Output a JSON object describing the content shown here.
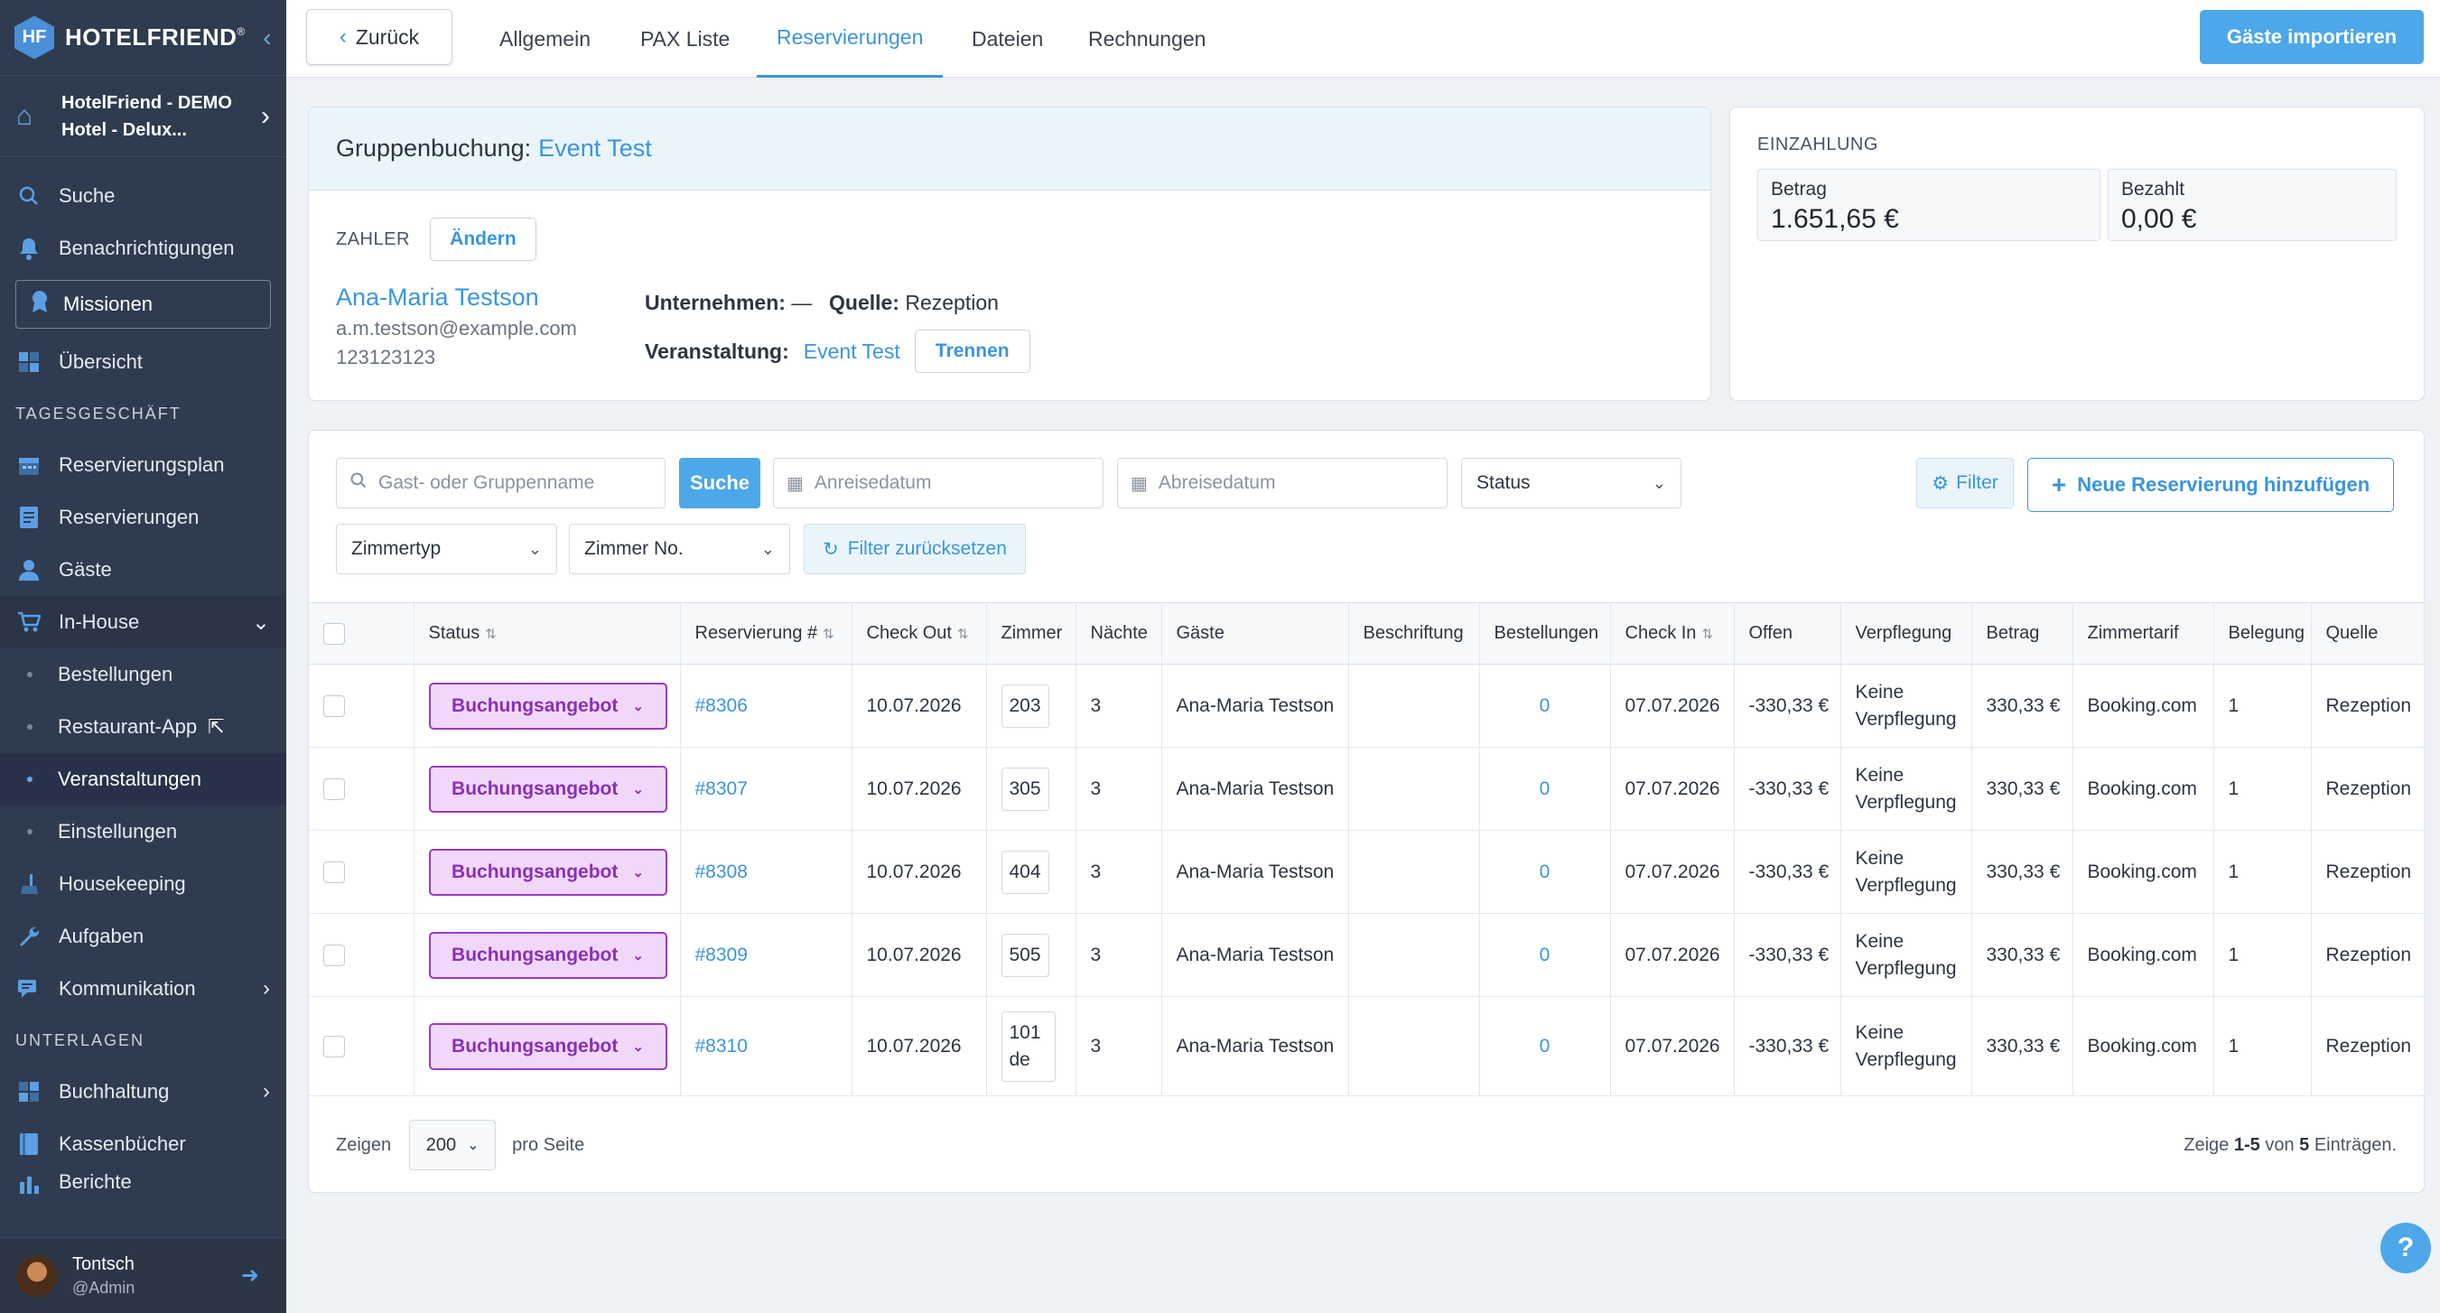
{
  "brand": {
    "name": "HOTELFRIEND",
    "logo_letters": "HF",
    "accent": "#3a95dd"
  },
  "sidebar": {
    "hotel": "HotelFriend - DEMO Hotel - Delux...",
    "search": "Suche",
    "notifications": "Benachrichtigungen",
    "missions": "Missionen",
    "overview": "Übersicht",
    "section_daily": "TAGESGESCHÄFT",
    "reservation_plan": "Reservierungsplan",
    "reservations": "Reservierungen",
    "guests": "Gäste",
    "inhouse": "In-House",
    "sub_orders": "Bestellungen",
    "sub_restaurant": "Restaurant-App",
    "sub_events": "Veranstaltungen",
    "sub_settings": "Einstellungen",
    "housekeeping": "Housekeeping",
    "tasks": "Aufgaben",
    "communication": "Kommunikation",
    "section_docs": "UNTERLAGEN",
    "accounting": "Buchhaltung",
    "cashbooks": "Kassenbücher",
    "reports_partial": "Berichte",
    "user_name": "Tontsch",
    "user_role": "@Admin"
  },
  "topbar": {
    "back": "Zurück",
    "tabs": [
      "Allgemein",
      "PAX Liste",
      "Reservierungen",
      "Dateien",
      "Rechnungen"
    ],
    "active_tab": "Reservierungen",
    "import": "Gäste importieren"
  },
  "group": {
    "title_prefix": "Gruppenbuchung:",
    "title_event": "Event Test",
    "payer_label": "ZAHLER",
    "change": "Ändern",
    "payer_name": "Ana-Maria Testson",
    "payer_email": "a.m.testson@example.com",
    "payer_phone": "123123123",
    "company_label": "Unternehmen:",
    "company_value": "—",
    "source_label": "Quelle:",
    "source_value": "Rezeption",
    "event_label": "Veranstaltung:",
    "event_value": "Event Test",
    "separate": "Trennen"
  },
  "deposit": {
    "label": "EINZAHLUNG",
    "amount_label": "Betrag",
    "amount_value": "1.651,65 €",
    "paid_label": "Bezahlt",
    "paid_value": "0,00 €"
  },
  "filters": {
    "search_placeholder": "Gast- oder Gruppenname",
    "search_btn": "Suche",
    "arrival_placeholder": "Anreisedatum",
    "departure_placeholder": "Abreisedatum",
    "status": "Status",
    "filter": "Filter",
    "new_reservation": "Neue Reservierung hinzufügen",
    "room_type": "Zimmertyp",
    "room_no": "Zimmer No.",
    "reset": "Filter zurücksetzen"
  },
  "table": {
    "headers": [
      "Status",
      "Reservierung #",
      "Check Out",
      "Zimmer",
      "Nächte",
      "Gäste",
      "Beschriftung",
      "Bestellungen",
      "Check In",
      "Offen",
      "Verpflegung",
      "Betrag",
      "Zimmertarif",
      "Belegung",
      "Quelle"
    ],
    "rows": [
      {
        "status": "Buchungsangebot",
        "res": "#8306",
        "checkout": "10.07.2026",
        "room": "203",
        "nights": "3",
        "guest": "Ana-Maria Testson",
        "label": "",
        "orders": "0",
        "checkin": "07.07.2026",
        "open": "-330,33 €",
        "board": "Keine Verpflegung",
        "amount": "330,33 €",
        "rate": "Booking.com",
        "occ": "1",
        "source": "Rezeption"
      },
      {
        "status": "Buchungsangebot",
        "res": "#8307",
        "checkout": "10.07.2026",
        "room": "305",
        "nights": "3",
        "guest": "Ana-Maria Testson",
        "label": "",
        "orders": "0",
        "checkin": "07.07.2026",
        "open": "-330,33 €",
        "board": "Keine Verpflegung",
        "amount": "330,33 €",
        "rate": "Booking.com",
        "occ": "1",
        "source": "Rezeption"
      },
      {
        "status": "Buchungsangebot",
        "res": "#8308",
        "checkout": "10.07.2026",
        "room": "404",
        "nights": "3",
        "guest": "Ana-Maria Testson",
        "label": "",
        "orders": "0",
        "checkin": "07.07.2026",
        "open": "-330,33 €",
        "board": "Keine Verpflegung",
        "amount": "330,33 €",
        "rate": "Booking.com",
        "occ": "1",
        "source": "Rezeption"
      },
      {
        "status": "Buchungsangebot",
        "res": "#8309",
        "checkout": "10.07.2026",
        "room": "505",
        "nights": "3",
        "guest": "Ana-Maria Testson",
        "label": "",
        "orders": "0",
        "checkin": "07.07.2026",
        "open": "-330,33 €",
        "board": "Keine Verpflegung",
        "amount": "330,33 €",
        "rate": "Booking.com",
        "occ": "1",
        "source": "Rezeption"
      },
      {
        "status": "Buchungsangebot",
        "res": "#8310",
        "checkout": "10.07.2026",
        "room": "101 de",
        "nights": "3",
        "guest": "Ana-Maria Testson",
        "label": "",
        "orders": "0",
        "checkin": "07.07.2026",
        "open": "-330,33 €",
        "board": "Keine Verpflegung",
        "amount": "330,33 €",
        "rate": "Booking.com",
        "occ": "1",
        "source": "Rezeption"
      }
    ]
  },
  "footer": {
    "show": "Zeigen",
    "per_page_value": "200",
    "per_page": "pro Seite",
    "summary_prefix": "Zeige",
    "summary_range": "1-5",
    "summary_mid": "von",
    "summary_total": "5",
    "summary_suffix": "Einträgen."
  },
  "help": "?"
}
